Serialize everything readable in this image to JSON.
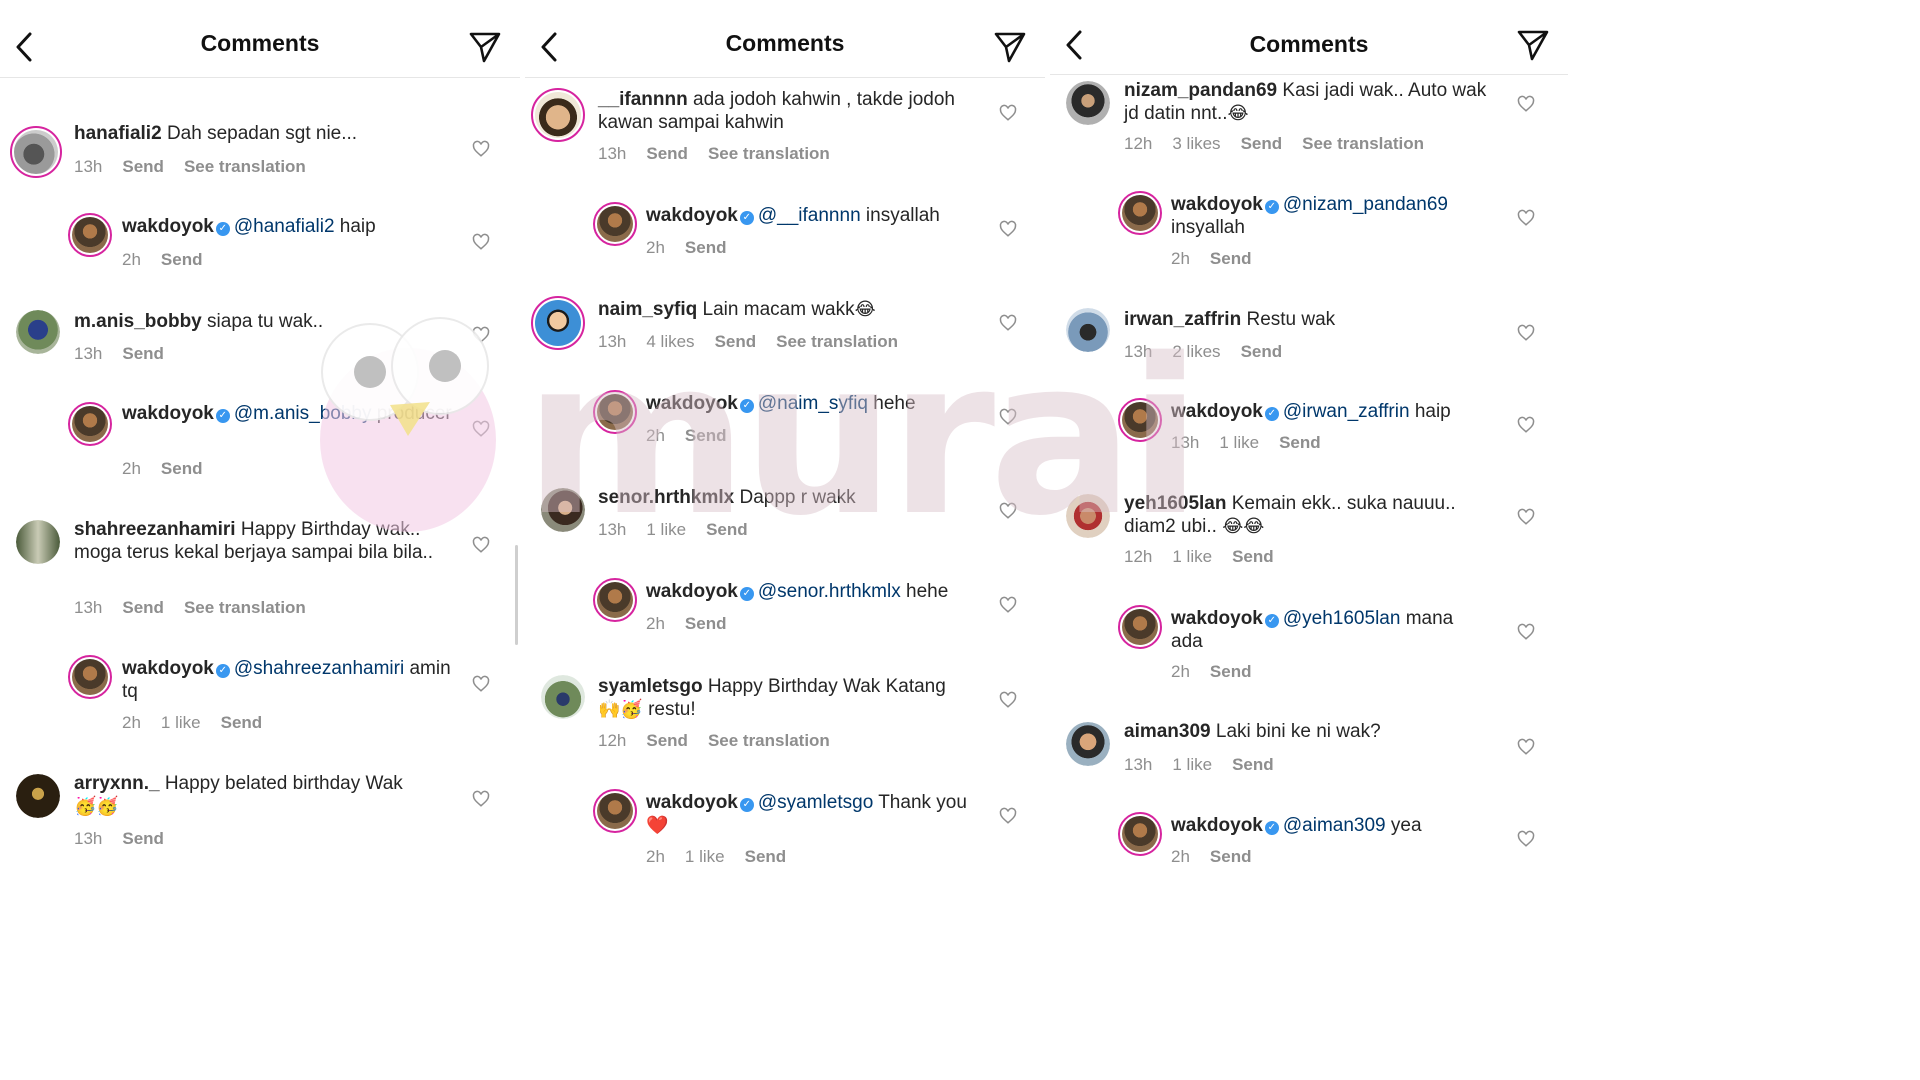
{
  "panels": [
    {
      "header": {
        "title": "Comments"
      },
      "comments": [
        {
          "user": "hanafiali2",
          "text": "Dah sepadan sgt nie...",
          "time": "13h",
          "likes": "",
          "send": "Send",
          "translate": "See translation"
        },
        {
          "user": "wakdoyok",
          "mention": "@hanafiali2",
          "text": "haip",
          "time": "2h",
          "likes": "",
          "send": "Send"
        },
        {
          "user": "m.anis_bobby",
          "text": "siapa tu wak..",
          "time": "13h",
          "send": "Send"
        },
        {
          "user": "wakdoyok",
          "mention": "@m.anis_bobby",
          "text": "producer",
          "time": "2h",
          "send": "Send"
        },
        {
          "user": "shahreezanhamiri",
          "text": "Happy Birthday wak.. moga terus kekal berjaya sampai bila bila..",
          "time": "13h",
          "send": "Send",
          "translate": "See translation"
        },
        {
          "user": "wakdoyok",
          "mention": "@shahreezanhamiri",
          "text": "amin tq",
          "time": "2h",
          "likes": "1 like",
          "send": "Send"
        },
        {
          "user": "arryxnn._",
          "text": "Happy belated birthday Wak",
          "emoji": "🥳🥳",
          "time": "13h",
          "send": "Send"
        }
      ]
    },
    {
      "header": {
        "title": "Comments"
      },
      "comments": [
        {
          "user": "__ifannnn",
          "text": "ada jodoh kahwin , takde jodoh kawan sampai kahwin",
          "time": "13h",
          "send": "Send",
          "translate": "See translation"
        },
        {
          "user": "wakdoyok",
          "mention": "@__ifannnn",
          "text": "insyallah",
          "time": "2h",
          "send": "Send"
        },
        {
          "user": "naim_syfiq",
          "text": "Lain macam wakk",
          "emoji": "😂",
          "time": "13h",
          "likes": "4 likes",
          "send": "Send",
          "translate": "See translation"
        },
        {
          "user": "wakdoyok",
          "mention": "@naim_syfiq",
          "text": "hehe",
          "time": "2h",
          "send": "Send"
        },
        {
          "user": "senor.hrthkmlx",
          "text": "Dappp r wakk",
          "time": "13h",
          "likes": "1 like",
          "send": "Send"
        },
        {
          "user": "wakdoyok",
          "mention": "@senor.hrthkmlx",
          "text": "hehe",
          "time": "2h",
          "send": "Send"
        },
        {
          "user": "syamletsgo",
          "text": "Happy Birthday Wak Katang",
          "emoji": "🙌🥳",
          "text2": "restu!",
          "time": "12h",
          "send": "Send",
          "translate": "See translation"
        },
        {
          "user": "wakdoyok",
          "mention": "@syamletsgo",
          "text": "Thank you",
          "emoji": "❤️",
          "time": "2h",
          "likes": "1 like",
          "send": "Send"
        }
      ]
    },
    {
      "header": {
        "title": "Comments"
      },
      "comments": [
        {
          "user": "nizam_pandan69",
          "text": "Kasi jadi wak.. Auto wak jd datin nnt..",
          "emoji": "😂",
          "time": "12h",
          "likes": "3 likes",
          "send": "Send",
          "translate": "See translation"
        },
        {
          "user": "wakdoyok",
          "mention": "@nizam_pandan69",
          "text": "insyallah",
          "time": "2h",
          "send": "Send"
        },
        {
          "user": "irwan_zaffrin",
          "text": "Restu wak",
          "time": "13h",
          "likes": "2 likes",
          "send": "Send"
        },
        {
          "user": "wakdoyok",
          "mention": "@irwan_zaffrin",
          "text": "haip",
          "time": "13h",
          "likes": "1 like",
          "send": "Send"
        },
        {
          "user": "yeh1605lan",
          "text": "Kemain ekk.. suka nauuu.. diam2 ubi..",
          "emoji": "😂😂",
          "time": "12h",
          "likes": "1 like",
          "send": "Send"
        },
        {
          "user": "wakdoyok",
          "mention": "@yeh1605lan",
          "text": "mana ada",
          "time": "2h",
          "send": "Send"
        },
        {
          "user": "aiman309",
          "text": "Laki bini ke ni wak?",
          "time": "13h",
          "likes": "1 like",
          "send": "Send"
        },
        {
          "user": "wakdoyok",
          "mention": "@aiman309",
          "text": "yea",
          "time": "2h",
          "send": "Send"
        }
      ]
    }
  ],
  "watermark": {
    "text": "murai"
  },
  "colors": {
    "mention": "#00376b",
    "meta": "#8e8e8e",
    "verified": "#3897f0",
    "ring": "#d6249f",
    "watermark": "#e9d6dc"
  },
  "icons": [
    "back-chevron-icon",
    "direct-send-icon",
    "heart-outline-icon",
    "verified-badge-icon"
  ]
}
